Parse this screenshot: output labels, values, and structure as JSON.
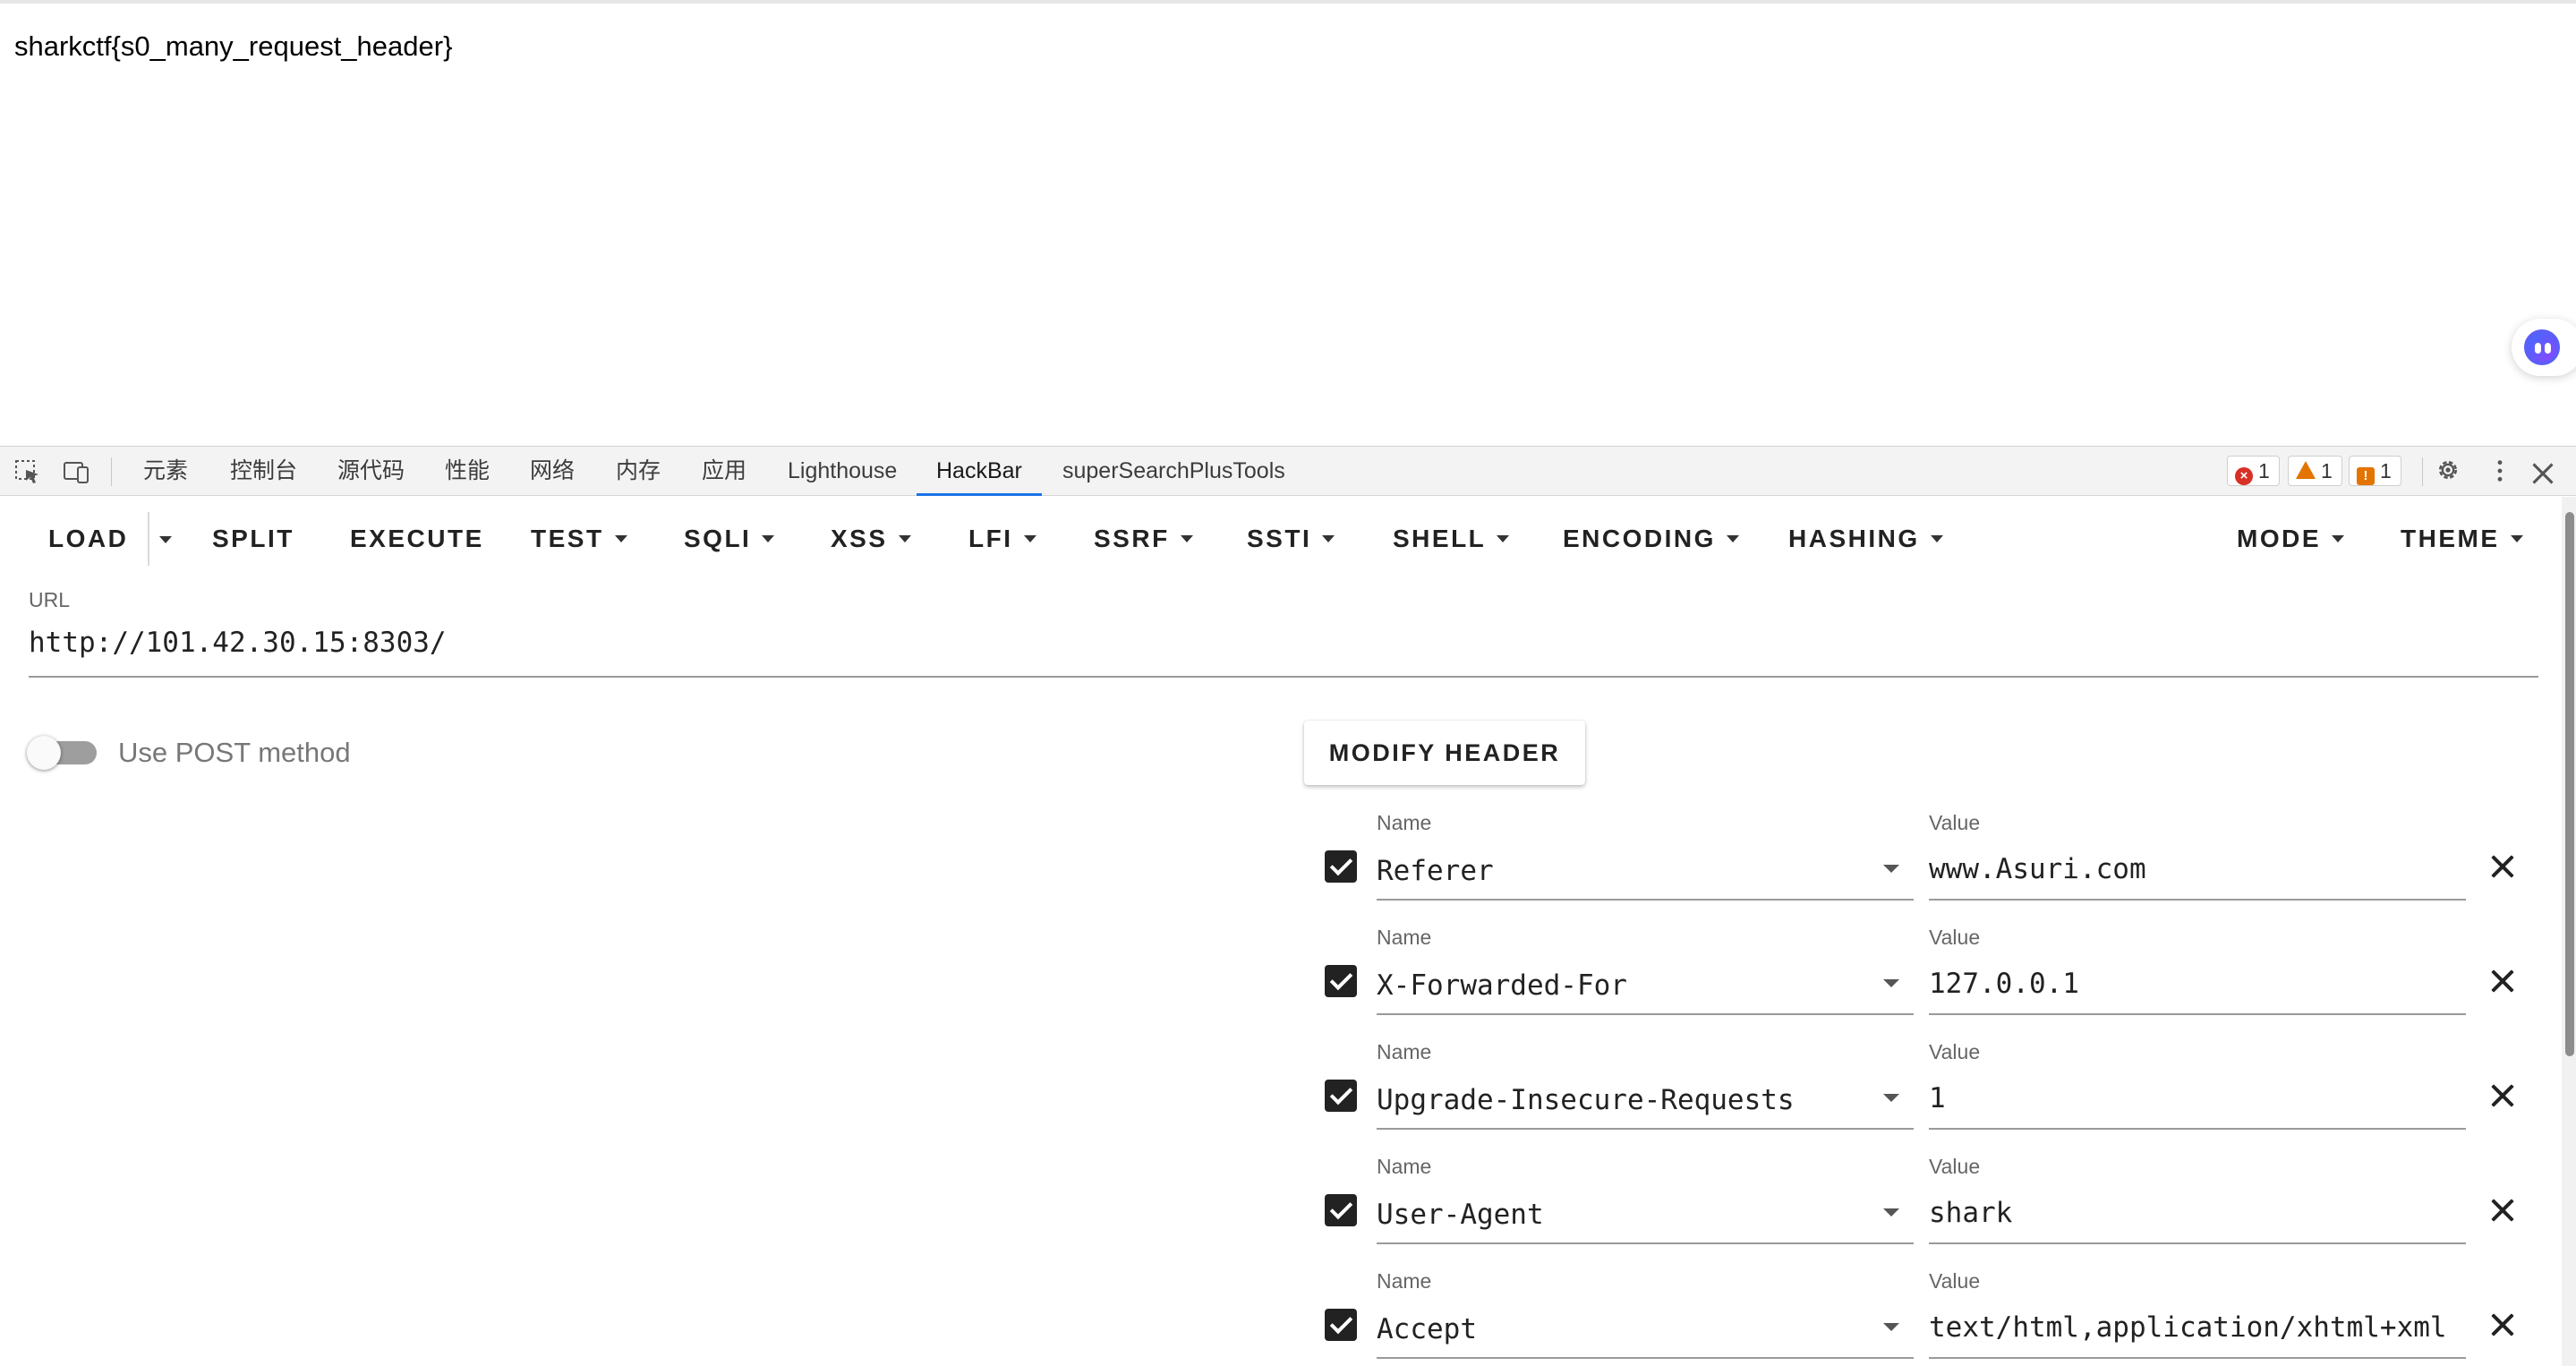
{
  "page": {
    "flag_text": "sharkctf{s0_many_request_header}"
  },
  "devtools": {
    "tabs": [
      "元素",
      "控制台",
      "源代码",
      "性能",
      "网络",
      "内存",
      "应用",
      "Lighthouse",
      "HackBar",
      "superSearchPlusTools"
    ],
    "active_tab": "HackBar",
    "error_count": "1",
    "warning_count": "1",
    "info_count": "1",
    "icons": [
      "inspect-element-icon",
      "device-toolbar-icon",
      "gear-icon",
      "more-vertical-icon",
      "close-icon"
    ]
  },
  "hackbar": {
    "toolbar": {
      "load": "LOAD",
      "split": "SPLIT",
      "execute": "EXECUTE",
      "test": "TEST",
      "sqli": "SQLI",
      "xss": "XSS",
      "lfi": "LFI",
      "ssrf": "SSRF",
      "ssti": "SSTI",
      "shell": "SHELL",
      "encoding": "ENCODING",
      "hashing": "HASHING",
      "mode": "MODE",
      "theme": "THEME"
    },
    "url_label": "URL",
    "url_value": "http://101.42.30.15:8303/",
    "post_method_label": "Use POST method",
    "post_method_enabled": false,
    "modify_header_label": "MODIFY HEADER",
    "name_label": "Name",
    "value_label": "Value",
    "headers": [
      {
        "name": "Referer",
        "value": "www.Asuri.com",
        "enabled": true
      },
      {
        "name": "X-Forwarded-For",
        "value": "127.0.0.1",
        "enabled": true
      },
      {
        "name": "Upgrade-Insecure-Requests",
        "value": "1",
        "enabled": true
      },
      {
        "name": "User-Agent",
        "value": "shark",
        "enabled": true
      },
      {
        "name": "Accept",
        "value": "text/html,application/xhtml+xml",
        "enabled": true
      }
    ]
  },
  "colors": {
    "active_tab_underline": "#1a73e8",
    "error": "#d93025",
    "warning": "#e37400"
  }
}
